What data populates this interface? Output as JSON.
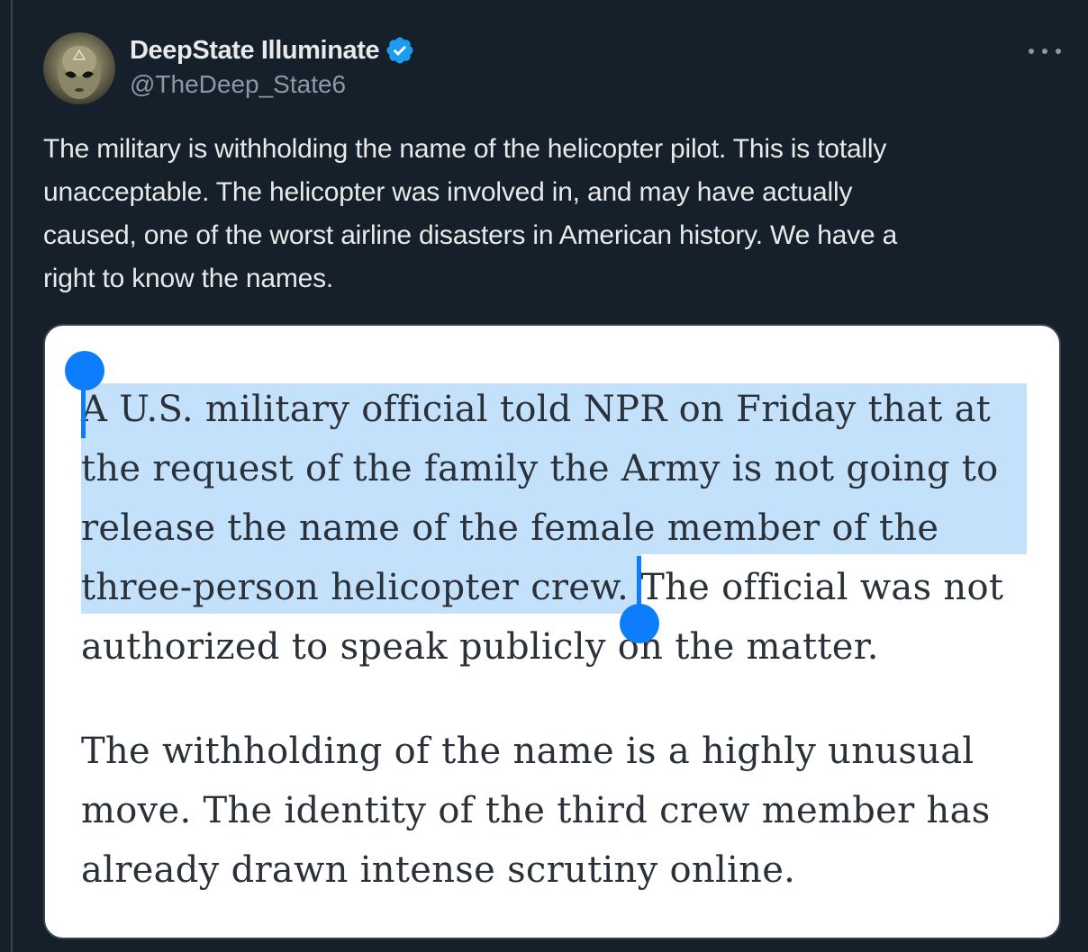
{
  "author": {
    "display_name": "DeepState Illuminate",
    "handle": "@TheDeep_State6",
    "verified": true,
    "avatar_icon": "alien-face-avatar"
  },
  "more_icon": "ellipsis-icon",
  "tweet": {
    "lines": [
      "The military is withholding the name of the helicopter pilot. This is totally",
      "unacceptable. The helicopter was involved in, and may have actually",
      "caused, one of the worst airline disasters in American history. We have a",
      "right to know the names."
    ]
  },
  "article_screenshot": {
    "paragraph_1": {
      "line_1": "A U.S. military official told NPR on Friday that at",
      "line_2": "the request of the family the Army is not going to",
      "line_3": "release the name of the female member of the",
      "line_4_selected": "three-person helicopter crew.",
      "line_4_rest": " The official was not",
      "line_5": "authorized to speak publicly on the matter."
    },
    "paragraph_2": {
      "line_1": "The withholding of the name is a highly unusual",
      "line_2": "move. The identity of the third crew member has",
      "line_3": "already drawn intense scrutiny online."
    },
    "selection_color": "#c4e1fc",
    "handle_color": "#0d7dfb"
  },
  "colors": {
    "background": "#15202b",
    "text_primary": "#e7e9ea",
    "text_secondary": "#8b98a5",
    "verified_badge": "#1d9bf0"
  }
}
